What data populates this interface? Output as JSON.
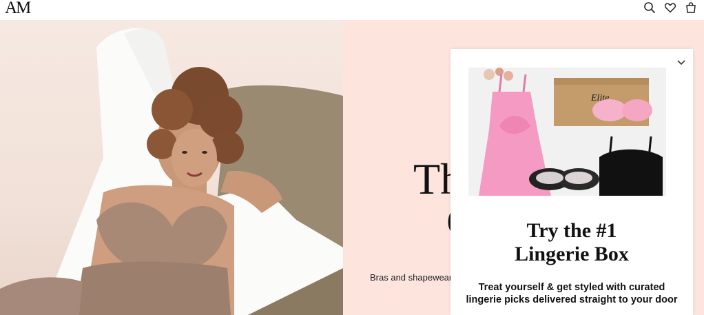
{
  "header": {
    "logo": "AM",
    "icons": [
      "search-icon",
      "heart-icon",
      "bag-icon"
    ]
  },
  "hero": {
    "headline": "Th\n   C",
    "subtitle": "Bras and shapewear"
  },
  "popup": {
    "title_line1": "Try the #1",
    "title_line2": "Lingerie Box",
    "description": "Treat yourself & get styled with curated lingerie picks delivered straight to your door",
    "box_brand": "Elite",
    "close_icon": "chevron-down-icon"
  },
  "colors": {
    "hero_bg": "#fde4dd",
    "accent_pink": "#f59bc3",
    "text": "#111111"
  }
}
